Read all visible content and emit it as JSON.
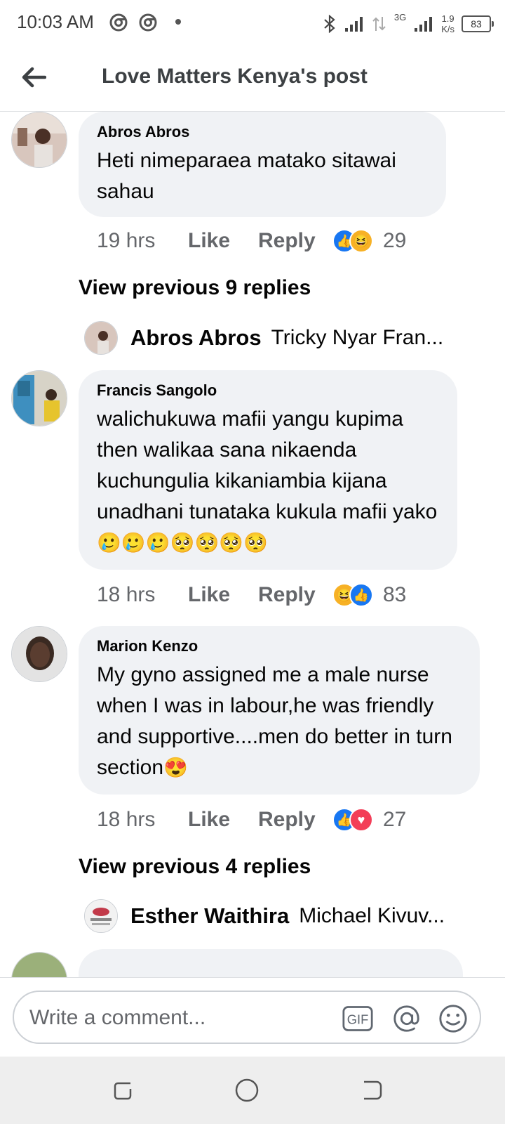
{
  "status_bar": {
    "time": "10:03 AM",
    "network": "3G",
    "speed_value": "1.9",
    "speed_unit": "K/s",
    "battery": "83"
  },
  "header": {
    "title": "Love Matters Kenya's post"
  },
  "comments": [
    {
      "author": "Abros Abros",
      "text": "Heti nimeparaea matako sitawai sahau",
      "time": "19 hrs",
      "like_label": "Like",
      "reply_label": "Reply",
      "reactions": [
        "like",
        "haha"
      ],
      "reaction_count": "29",
      "view_previous": "View previous 9 replies",
      "latest_reply": {
        "author": "Abros Abros",
        "text": "Tricky Nyar Fran..."
      }
    },
    {
      "author": "Francis Sangolo",
      "text": "walichukuwa mafii yangu kupima then walikaa sana nikaenda kuchungulia kikaniambia kijana unadhani tunataka kukula mafii yako",
      "emojis": "🥲🥲🥲🥺🥺🥺🥺",
      "time": "18 hrs",
      "like_label": "Like",
      "reply_label": "Reply",
      "reactions": [
        "haha",
        "like"
      ],
      "reaction_count": "83"
    },
    {
      "author": "Marion Kenzo",
      "text": "My gyno assigned me a male nurse when I was in labour,he was friendly and supportive....men do better in turn section",
      "emojis": "😍",
      "time": "18 hrs",
      "like_label": "Like",
      "reply_label": "Reply",
      "reactions": [
        "like",
        "love"
      ],
      "reaction_count": "27",
      "view_previous": "View previous 4 replies",
      "latest_reply": {
        "author": "Esther Waithira",
        "text": "Michael Kivuv..."
      }
    }
  ],
  "composer": {
    "placeholder": "Write a comment...",
    "gif_label": "GIF"
  },
  "colors": {
    "bubble": "#f0f2f5",
    "like_blue": "#1877f2",
    "haha_yellow": "#f7b125",
    "love_red": "#f33e58",
    "meta_gray": "#65676b"
  }
}
